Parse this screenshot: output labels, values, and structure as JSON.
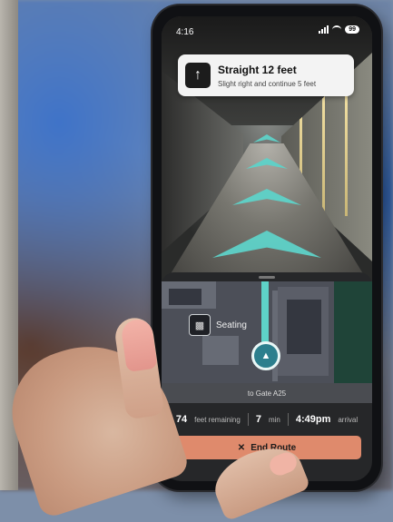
{
  "status_bar": {
    "time": "4:16",
    "battery": "99"
  },
  "instruction": {
    "title": "Straight 12 feet",
    "subtitle": "Slight right and continue 5 feet",
    "icon": "arrow-up-icon"
  },
  "map": {
    "poi_label": "Seating",
    "poi_icon": "seating-icon",
    "location_icon": "navigation-arrow-icon",
    "route_color": "#5ed2c8"
  },
  "destination": "to Gate A25",
  "stats": {
    "feet_value": "74",
    "feet_label": "feet remaining",
    "minutes_value": "7",
    "minutes_label": "min",
    "arrival_value": "4:49pm",
    "arrival_label": "arrival"
  },
  "end_button": {
    "label": "End Route",
    "icon": "close-icon",
    "color": "#df8a6c"
  }
}
